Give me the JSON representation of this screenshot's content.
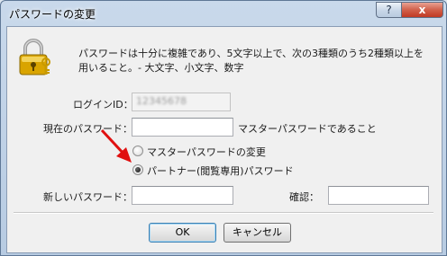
{
  "window": {
    "title": "パスワードの変更",
    "help_button": "?",
    "close_button": "x"
  },
  "message": "パスワードは十分に複雑であり、5文字以上で、次の3種類のうち2種類以上を用いること。- 大文字、小文字、数字",
  "login": {
    "label": "ログインID：",
    "value": "12345678"
  },
  "current_password": {
    "label": "現在のパスワード：",
    "value": "",
    "hint": "マスターパスワードであること"
  },
  "change_type": {
    "options": [
      "マスターパスワードの変更",
      "パートナー(閲覧専用)パスワード"
    ],
    "selected": 1
  },
  "new_password": {
    "label": "新しいパスワード：",
    "value": ""
  },
  "confirm": {
    "label": "確認：",
    "value": ""
  },
  "buttons": {
    "ok": "OK",
    "cancel": "キャンセル"
  },
  "colors": {
    "arrow": "#e01010",
    "lock_gold": "#d9a400",
    "window_frame": "#b7cbe2"
  }
}
